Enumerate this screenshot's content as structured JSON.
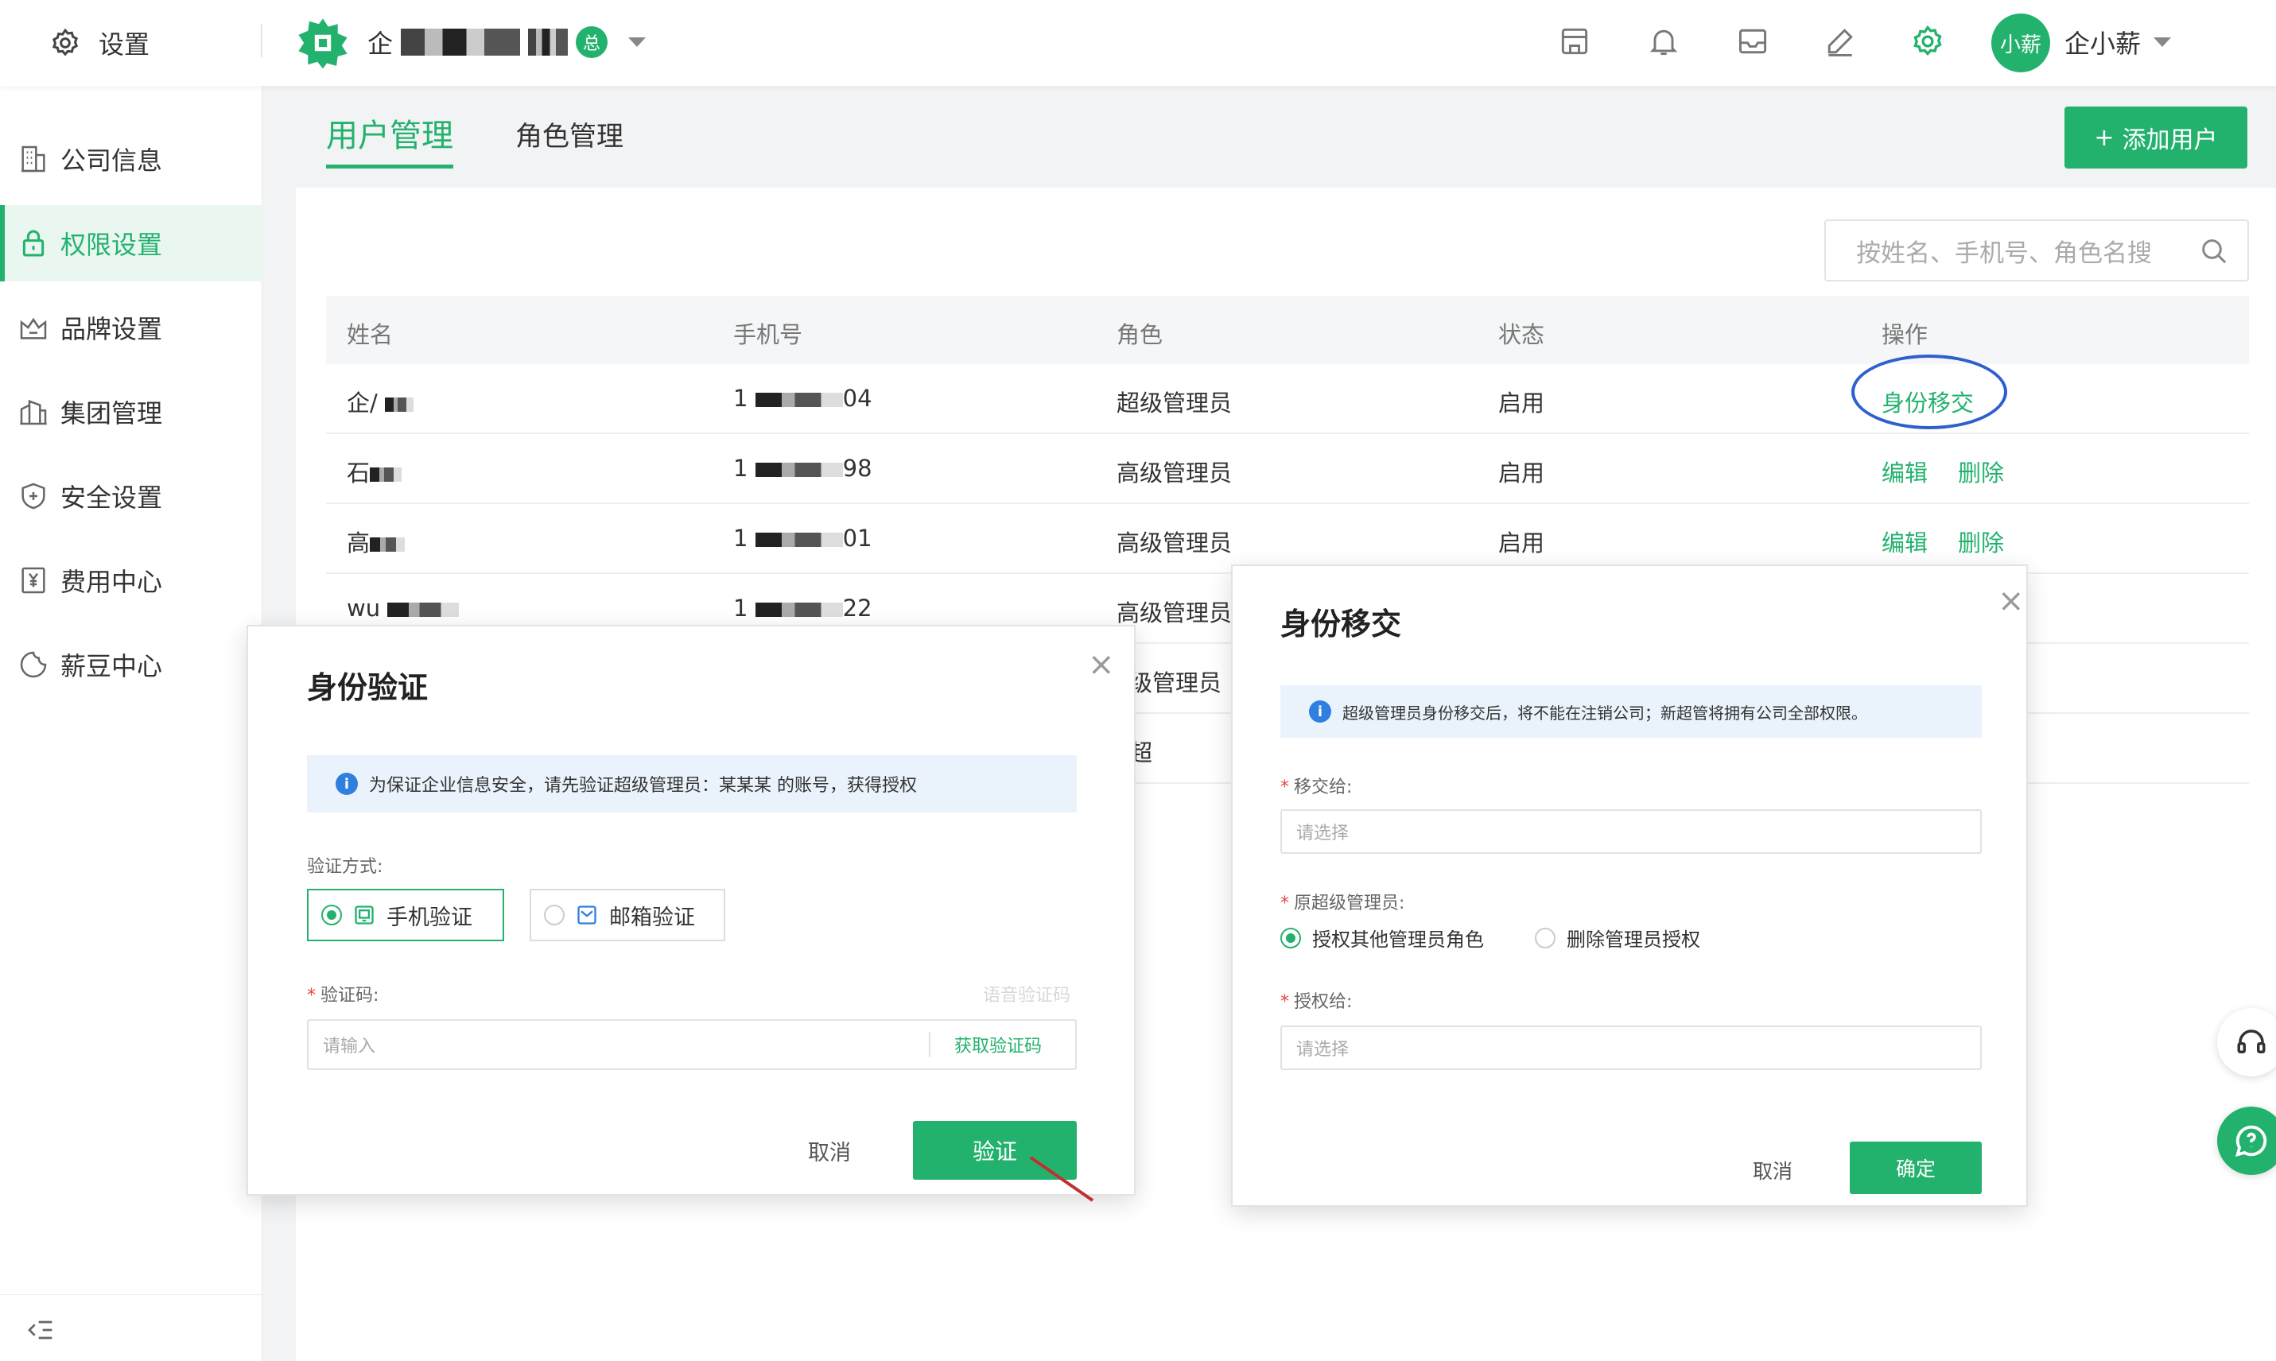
{
  "colors": {
    "accent": "#23b26d",
    "info": "#2f7fe0",
    "highlight_oval": "#2f5fcf",
    "required": "#e54545"
  },
  "topbar": {
    "settings_label": "设置",
    "company_prefix": "企",
    "company_badge": "总",
    "user_avatar": "小薪",
    "user_name": "企小薪",
    "icons": [
      "store-icon",
      "bell-icon",
      "inbox-icon",
      "edit-icon",
      "gear-icon"
    ]
  },
  "sidebar": {
    "items": [
      {
        "label": "公司信息",
        "icon": "building-icon",
        "active": false
      },
      {
        "label": "权限设置",
        "icon": "lock-icon",
        "active": true
      },
      {
        "label": "品牌设置",
        "icon": "crown-icon",
        "active": false
      },
      {
        "label": "集团管理",
        "icon": "buildings-icon",
        "active": false
      },
      {
        "label": "安全设置",
        "icon": "shield-icon",
        "active": false
      },
      {
        "label": "费用中心",
        "icon": "yen-icon",
        "active": false
      },
      {
        "label": "薪豆中心",
        "icon": "bean-icon",
        "active": false
      }
    ]
  },
  "tabs": [
    {
      "label": "用户管理",
      "active": true
    },
    {
      "label": "角色管理",
      "active": false
    }
  ],
  "add_user_label": "添加用户",
  "search": {
    "placeholder": "按姓名、手机号、角色名搜"
  },
  "table": {
    "headers": [
      "姓名",
      "手机号",
      "角色",
      "状态",
      "操作"
    ],
    "rows": [
      {
        "name": "企/",
        "phone_start": "1",
        "phone_end": "04",
        "role": "超级管理员",
        "status": "启用",
        "actions": [
          "身份移交"
        ]
      },
      {
        "name": "石",
        "phone_start": "1",
        "phone_end": "98",
        "role": "高级管理员",
        "status": "启用",
        "actions": [
          "编辑",
          "删除"
        ]
      },
      {
        "name": "高",
        "phone_start": "1",
        "phone_end": "01",
        "role": "高级管理员",
        "status": "启用",
        "actions": [
          "编辑",
          "删除"
        ]
      },
      {
        "name": "wu",
        "phone_start": "1",
        "phone_end": "22",
        "role": "高级管理员",
        "status": "",
        "actions": []
      },
      {
        "name": "",
        "phone_start": "",
        "phone_end": "",
        "role": "级管理员",
        "status": "",
        "actions": []
      },
      {
        "name": "",
        "phone_start": "",
        "phone_end": "",
        "role": "超",
        "status": "",
        "actions": []
      }
    ]
  },
  "verify_dialog": {
    "title": "身份验证",
    "info": "为保证企业信息安全，请先验证超级管理员：某某某 的账号，获得授权",
    "method_label": "验证方式:",
    "methods": [
      {
        "label": "手机验证",
        "selected": true
      },
      {
        "label": "邮箱验证",
        "selected": false
      }
    ],
    "code_label": "验证码:",
    "voice_code": "语音验证码",
    "code_placeholder": "请输入",
    "get_code": "获取验证码",
    "cancel": "取消",
    "confirm": "验证"
  },
  "transfer_dialog": {
    "title": "身份移交",
    "info": "超级管理员身份移交后，将不能在注销公司；新超管将拥有公司全部权限。",
    "transfer_to_label": "移交给:",
    "transfer_to_placeholder": "请选择",
    "original_label": "原超级管理员:",
    "options": [
      {
        "label": "授权其他管理员角色",
        "selected": true
      },
      {
        "label": "删除管理员授权",
        "selected": false
      }
    ],
    "grant_label": "授权给:",
    "grant_placeholder": "请选择",
    "cancel": "取消",
    "confirm": "确定"
  }
}
